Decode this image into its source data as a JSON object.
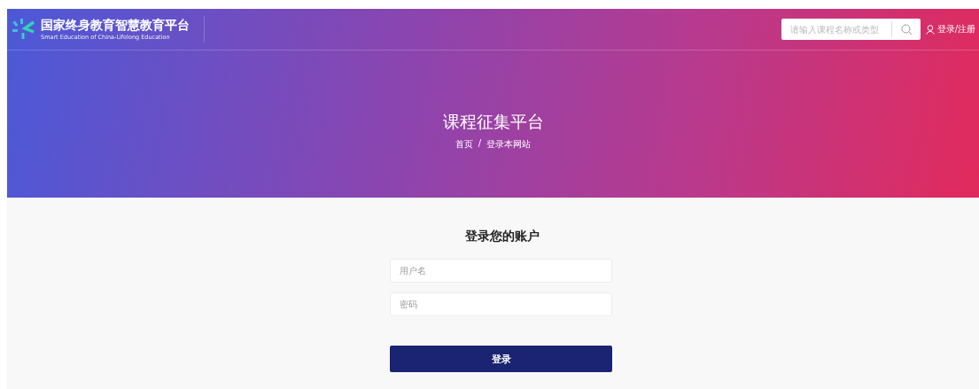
{
  "header": {
    "logo_title": "国家终身教育智慧教育平台",
    "logo_subtitle": "Smart Education of China-Lifelong Education",
    "search": {
      "placeholder": "请输入课程名称或类型"
    },
    "login_link": "登录/注册"
  },
  "hero": {
    "title": "课程征集平台",
    "breadcrumb": [
      "首页",
      "登录本网站"
    ],
    "separator": "/"
  },
  "login_form": {
    "heading": "登录您的账户",
    "fields": [
      {
        "placeholder": "用户名"
      },
      {
        "placeholder": "密码"
      }
    ],
    "submit": "登录"
  }
}
